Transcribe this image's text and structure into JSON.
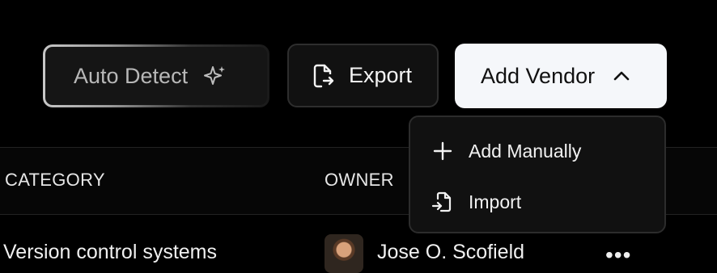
{
  "toolbar": {
    "auto_detect_label": "Auto Detect",
    "export_label": "Export",
    "add_vendor_label": "Add Vendor"
  },
  "dropdown": {
    "items": [
      {
        "label": "Add Manually",
        "icon": "plus-icon"
      },
      {
        "label": "Import",
        "icon": "import-file-icon"
      }
    ]
  },
  "table": {
    "columns": [
      "CATEGORY",
      "OWNER"
    ],
    "rows": [
      {
        "category": "Version control systems",
        "owner": "Jose O. Scofield"
      }
    ]
  }
}
